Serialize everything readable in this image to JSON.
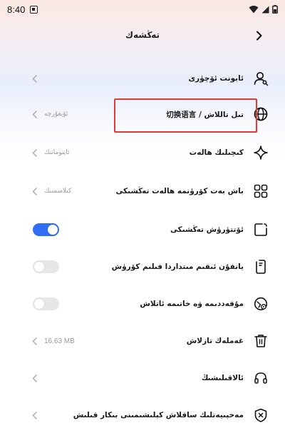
{
  "status_bar": {
    "time": "8:40",
    "left_icon": "sim-card-icon",
    "right_icons": [
      "wifi-icon",
      "signal-icon",
      "battery-icon"
    ]
  },
  "header": {
    "title": "تەڭشەك",
    "back_icon": "chevron-right-icon"
  },
  "rows": [
    {
      "id": "account",
      "icon": "user-key-icon",
      "label": "ئابونت ئۆچۈرى",
      "value": "",
      "control": "chevron"
    },
    {
      "id": "language",
      "icon": "globe-icon",
      "label": "تىل تاللاش / 切换语言",
      "value": "ئۇيغۇرچە",
      "control": "chevron"
    },
    {
      "id": "theme",
      "icon": "sparkle-icon",
      "label": "كىچىلىك ھالەت",
      "value": "ئاپتوماتىك",
      "control": "chevron"
    },
    {
      "id": "home_layout",
      "icon": "grid-icon",
      "label": "باش بەت كۆرۈنمە ھالەت تەڭشىكى",
      "value": "كىلاسسىك",
      "control": "chevron"
    },
    {
      "id": "autoplay",
      "icon": "play-square-icon",
      "label": "ئۆتتۈرۈش تەڭشىكى",
      "value": "",
      "control": "toggle",
      "state": "on"
    },
    {
      "id": "player",
      "icon": "phone-rotate-icon",
      "label": "يانفۇن ئىقىم مىتداردا فىلىم كۆرۈش",
      "value": "",
      "control": "toggle",
      "state": "off"
    },
    {
      "id": "sleep",
      "icon": "timer-play-icon",
      "label": "مۇقەددىمە ۋە خاتىمە ئاتلاش",
      "value": "",
      "control": "toggle",
      "state": "off"
    },
    {
      "id": "cache",
      "icon": "trash-icon",
      "label": "غەملەك تازلاش",
      "value": "16.63 MB",
      "control": "chevron"
    },
    {
      "id": "feedback",
      "icon": "headset-icon",
      "label": "ئالاقىلىشىڭ",
      "value": "",
      "control": "chevron"
    },
    {
      "id": "privacy",
      "icon": "shield-x-icon",
      "label": "مەخپىيەتلىك ساقلاش كېلىشىمىنى بىكار قىلىش",
      "value": "",
      "control": "chevron"
    }
  ],
  "colors": {
    "accent": "#2f6ef5",
    "highlight_border": "#e53935",
    "toggle_off": "#e7e7ea",
    "muted_text": "#9a9a9a"
  }
}
